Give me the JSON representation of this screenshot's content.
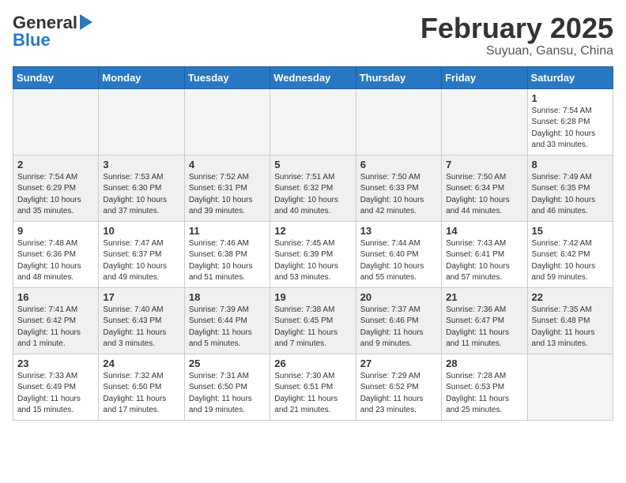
{
  "header": {
    "logo_general": "General",
    "logo_blue": "Blue",
    "month_title": "February 2025",
    "location": "Suyuan, Gansu, China"
  },
  "weekdays": [
    "Sunday",
    "Monday",
    "Tuesday",
    "Wednesday",
    "Thursday",
    "Friday",
    "Saturday"
  ],
  "weeks": [
    [
      {
        "day": "",
        "info": ""
      },
      {
        "day": "",
        "info": ""
      },
      {
        "day": "",
        "info": ""
      },
      {
        "day": "",
        "info": ""
      },
      {
        "day": "",
        "info": ""
      },
      {
        "day": "",
        "info": ""
      },
      {
        "day": "1",
        "info": "Sunrise: 7:54 AM\nSunset: 6:28 PM\nDaylight: 10 hours\nand 33 minutes."
      }
    ],
    [
      {
        "day": "2",
        "info": "Sunrise: 7:54 AM\nSunset: 6:29 PM\nDaylight: 10 hours\nand 35 minutes."
      },
      {
        "day": "3",
        "info": "Sunrise: 7:53 AM\nSunset: 6:30 PM\nDaylight: 10 hours\nand 37 minutes."
      },
      {
        "day": "4",
        "info": "Sunrise: 7:52 AM\nSunset: 6:31 PM\nDaylight: 10 hours\nand 39 minutes."
      },
      {
        "day": "5",
        "info": "Sunrise: 7:51 AM\nSunset: 6:32 PM\nDaylight: 10 hours\nand 40 minutes."
      },
      {
        "day": "6",
        "info": "Sunrise: 7:50 AM\nSunset: 6:33 PM\nDaylight: 10 hours\nand 42 minutes."
      },
      {
        "day": "7",
        "info": "Sunrise: 7:50 AM\nSunset: 6:34 PM\nDaylight: 10 hours\nand 44 minutes."
      },
      {
        "day": "8",
        "info": "Sunrise: 7:49 AM\nSunset: 6:35 PM\nDaylight: 10 hours\nand 46 minutes."
      }
    ],
    [
      {
        "day": "9",
        "info": "Sunrise: 7:48 AM\nSunset: 6:36 PM\nDaylight: 10 hours\nand 48 minutes."
      },
      {
        "day": "10",
        "info": "Sunrise: 7:47 AM\nSunset: 6:37 PM\nDaylight: 10 hours\nand 49 minutes."
      },
      {
        "day": "11",
        "info": "Sunrise: 7:46 AM\nSunset: 6:38 PM\nDaylight: 10 hours\nand 51 minutes."
      },
      {
        "day": "12",
        "info": "Sunrise: 7:45 AM\nSunset: 6:39 PM\nDaylight: 10 hours\nand 53 minutes."
      },
      {
        "day": "13",
        "info": "Sunrise: 7:44 AM\nSunset: 6:40 PM\nDaylight: 10 hours\nand 55 minutes."
      },
      {
        "day": "14",
        "info": "Sunrise: 7:43 AM\nSunset: 6:41 PM\nDaylight: 10 hours\nand 57 minutes."
      },
      {
        "day": "15",
        "info": "Sunrise: 7:42 AM\nSunset: 6:42 PM\nDaylight: 10 hours\nand 59 minutes."
      }
    ],
    [
      {
        "day": "16",
        "info": "Sunrise: 7:41 AM\nSunset: 6:42 PM\nDaylight: 11 hours\nand 1 minute."
      },
      {
        "day": "17",
        "info": "Sunrise: 7:40 AM\nSunset: 6:43 PM\nDaylight: 11 hours\nand 3 minutes."
      },
      {
        "day": "18",
        "info": "Sunrise: 7:39 AM\nSunset: 6:44 PM\nDaylight: 11 hours\nand 5 minutes."
      },
      {
        "day": "19",
        "info": "Sunrise: 7:38 AM\nSunset: 6:45 PM\nDaylight: 11 hours\nand 7 minutes."
      },
      {
        "day": "20",
        "info": "Sunrise: 7:37 AM\nSunset: 6:46 PM\nDaylight: 11 hours\nand 9 minutes."
      },
      {
        "day": "21",
        "info": "Sunrise: 7:36 AM\nSunset: 6:47 PM\nDaylight: 11 hours\nand 11 minutes."
      },
      {
        "day": "22",
        "info": "Sunrise: 7:35 AM\nSunset: 6:48 PM\nDaylight: 11 hours\nand 13 minutes."
      }
    ],
    [
      {
        "day": "23",
        "info": "Sunrise: 7:33 AM\nSunset: 6:49 PM\nDaylight: 11 hours\nand 15 minutes."
      },
      {
        "day": "24",
        "info": "Sunrise: 7:32 AM\nSunset: 6:50 PM\nDaylight: 11 hours\nand 17 minutes."
      },
      {
        "day": "25",
        "info": "Sunrise: 7:31 AM\nSunset: 6:50 PM\nDaylight: 11 hours\nand 19 minutes."
      },
      {
        "day": "26",
        "info": "Sunrise: 7:30 AM\nSunset: 6:51 PM\nDaylight: 11 hours\nand 21 minutes."
      },
      {
        "day": "27",
        "info": "Sunrise: 7:29 AM\nSunset: 6:52 PM\nDaylight: 11 hours\nand 23 minutes."
      },
      {
        "day": "28",
        "info": "Sunrise: 7:28 AM\nSunset: 6:53 PM\nDaylight: 11 hours\nand 25 minutes."
      },
      {
        "day": "",
        "info": ""
      }
    ]
  ]
}
